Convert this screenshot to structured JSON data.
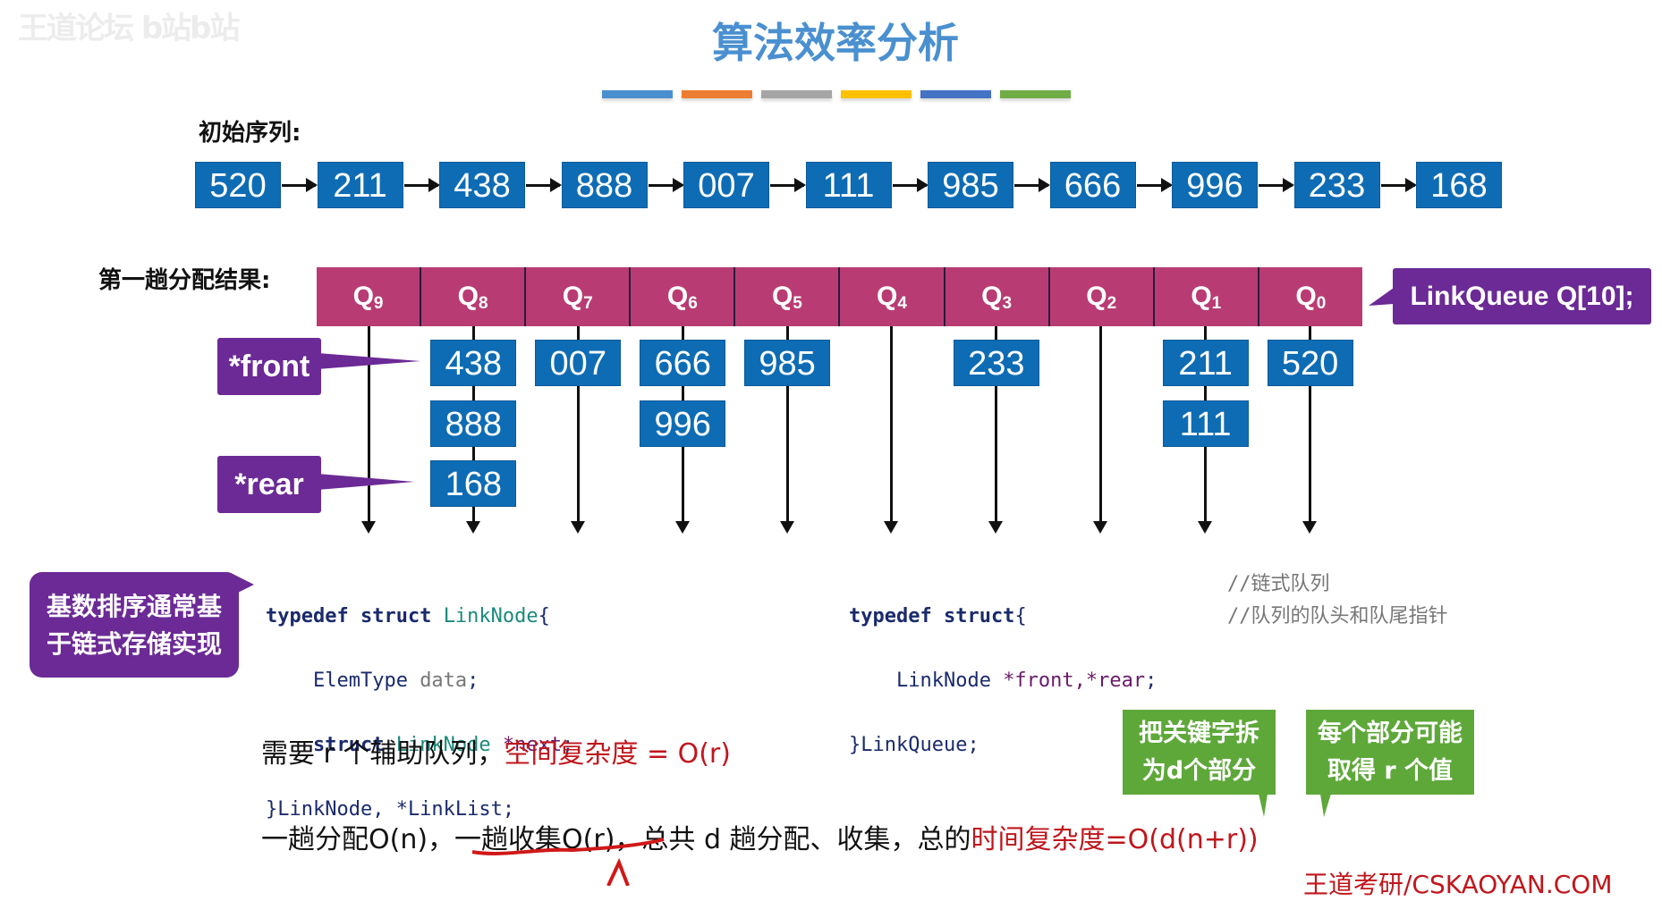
{
  "watermark_top": "王道论坛 b站b站",
  "title": "算法效率分析",
  "color_bars": [
    "#4a90d0",
    "#ed7d31",
    "#a5a5a5",
    "#ffc000",
    "#4472c4",
    "#70ad47"
  ],
  "initial_label": "初始序列:",
  "initial_sequence": [
    "520",
    "211",
    "438",
    "888",
    "007",
    "111",
    "985",
    "666",
    "996",
    "233",
    "168"
  ],
  "first_pass_label": "第一趟分配结果:",
  "queues": [
    {
      "name": "Q",
      "sub": "9",
      "items": []
    },
    {
      "name": "Q",
      "sub": "8",
      "items": [
        "438",
        "888",
        "168"
      ]
    },
    {
      "name": "Q",
      "sub": "7",
      "items": [
        "007"
      ]
    },
    {
      "name": "Q",
      "sub": "6",
      "items": [
        "666",
        "996"
      ]
    },
    {
      "name": "Q",
      "sub": "5",
      "items": [
        "985"
      ]
    },
    {
      "name": "Q",
      "sub": "4",
      "items": []
    },
    {
      "name": "Q",
      "sub": "3",
      "items": [
        "233"
      ]
    },
    {
      "name": "Q",
      "sub": "2",
      "items": []
    },
    {
      "name": "Q",
      "sub": "1",
      "items": [
        "211",
        "111"
      ]
    },
    {
      "name": "Q",
      "sub": "0",
      "items": [
        "520"
      ]
    }
  ],
  "linkqueue_label": "LinkQueue Q[10];",
  "front_label": "*front",
  "rear_label": "*rear",
  "callout_left": [
    "基数排序通常基",
    "于链式存储实现"
  ],
  "code_left": {
    "l1_kw": "typedef struct ",
    "l1_ty": "LinkNode",
    "l1_end": "{",
    "l2_ty": "    ElemType ",
    "l2_id": "data",
    "l2_end": ";",
    "l3_kw": "    struct ",
    "l3_ty": "LinkNode ",
    "l3_id": "*next",
    "l3_end": ";",
    "l4": "}LinkNode, *LinkList;"
  },
  "code_right": {
    "l1_kw": "typedef struct",
    "l1_end": "{",
    "l1_comment": "//链式队列",
    "l2_ty": "    LinkNode ",
    "l2_id": "*front,*rear",
    "l2_end": ";",
    "l2_comment": "//队列的队头和队尾指针",
    "l3": "}LinkQueue;"
  },
  "space_line": {
    "black": "需要 r 个辅助队列，",
    "red": "空间复杂度 = O(r)"
  },
  "time_line": {
    "p1": "一趟分配O(n)，",
    "p2": "一趟收集O(r)",
    "p3": "，总共 d 趟分配、收集，总的",
    "red": "时间复杂度=O(d(n+r))"
  },
  "green_callouts": [
    [
      "把关键字拆",
      "为d个部分"
    ],
    [
      "每个部分可能",
      "取得 r 个值"
    ]
  ],
  "watermark_bottom": "王道考研/CSKAOYAN.COM",
  "colors": {
    "seq_box": "#0e6cb4",
    "queue_bar": "#b83c73",
    "purple": "#6b2a95",
    "green": "#5ea83a",
    "red": "#c0161c",
    "title": "#4a90d0"
  }
}
